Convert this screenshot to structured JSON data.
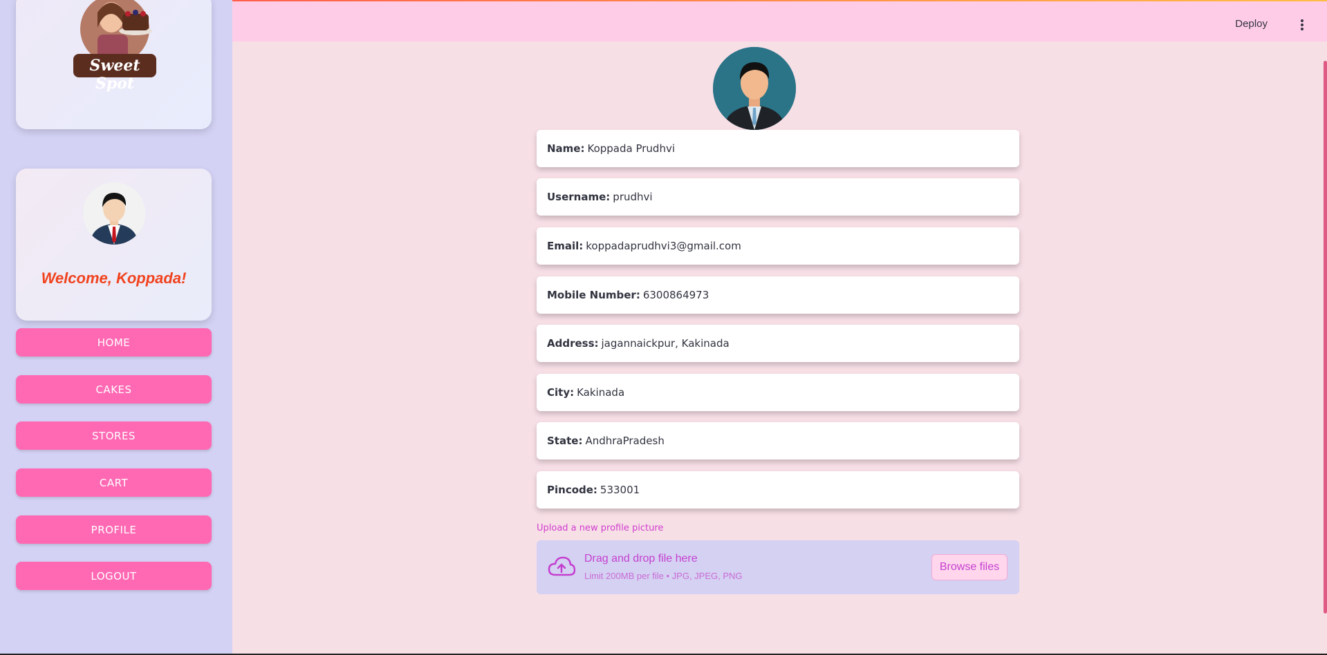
{
  "header": {
    "deploy_label": "Deploy"
  },
  "sidebar": {
    "logo_text": "Sweet Spot",
    "welcome": "Welcome, Koppada!",
    "nav": [
      "HOME",
      "CAKES",
      "STORES",
      "CART",
      "PROFILE",
      "LOGOUT"
    ]
  },
  "profile": {
    "fields": [
      {
        "label": "Name:",
        "value": "Koppada Prudhvi"
      },
      {
        "label": "Username:",
        "value": "prudhvi"
      },
      {
        "label": "Email:",
        "value": "koppadaprudhvi3@gmail.com"
      },
      {
        "label": "Mobile Number:",
        "value": "6300864973"
      },
      {
        "label": "Address:",
        "value": "jagannaickpur, Kakinada"
      },
      {
        "label": "City:",
        "value": "Kakinada"
      },
      {
        "label": "State:",
        "value": "AndhraPradesh"
      },
      {
        "label": "Pincode:",
        "value": "533001"
      }
    ]
  },
  "upload": {
    "label": "Upload a new profile picture",
    "dropzone_title": "Drag and drop file here",
    "dropzone_limit": "Limit 200MB per file • JPG, JPEG, PNG",
    "browse_label": "Browse files"
  },
  "colors": {
    "nav_button": "#ff69b4",
    "header": "#ffcce8",
    "sidebar": "#d4d2f4",
    "accent_text": "#c43fd0",
    "welcome": "#f0421d"
  }
}
